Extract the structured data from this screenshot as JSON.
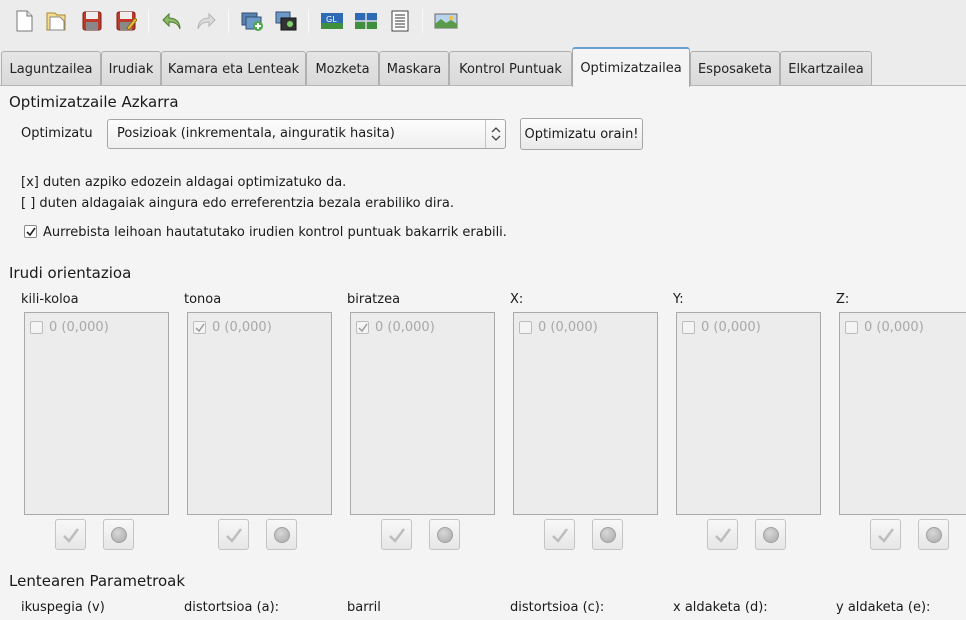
{
  "toolbar": {
    "icons": [
      "new-file-icon",
      "open-file-icon",
      "save-icon",
      "save-as-icon",
      "undo-icon",
      "redo-icon",
      "add-images-icon",
      "add-control-points-icon",
      "gl-preview-icon",
      "preview-icon",
      "list-icon",
      "panorama-icon"
    ],
    "gl_label": "GL"
  },
  "tabs": [
    "Laguntzailea",
    "Irudiak",
    "Kamara eta Lenteak",
    "Mozketa",
    "Maskara",
    "Kontrol Puntuak",
    "Optimizatzailea",
    "Esposaketa",
    "Elkartzailea"
  ],
  "active_tab": "Optimizatzailea",
  "optimizer": {
    "heading": "Optimizatzaile Azkarra",
    "optimize_label": "Optimizatu",
    "combo_value": "Posizioak (inkrementala, ainguratik hasita)",
    "optimize_now": "Optimizatu orain!",
    "info1": "[x] duten azpiko edozein aldagai optimizatuko da.",
    "info2": "[ ] duten aldagaiak aingura edo erreferentzia bezala erabiliko dira.",
    "preview_only_label": "Aurrebista leihoan hautatutako irudien kontrol puntuak bakarrik erabili.",
    "preview_only_checked": true
  },
  "orientation": {
    "heading": "Irudi orientazioa",
    "columns": [
      {
        "label": "kili-koloa",
        "item": "0 (0,000)",
        "checked": false
      },
      {
        "label": "tonoa",
        "item": "0 (0,000)",
        "checked": true
      },
      {
        "label": "biratzea",
        "item": "0 (0,000)",
        "checked": true
      },
      {
        "label": "X:",
        "item": "0 (0,000)",
        "checked": false
      },
      {
        "label": "Y:",
        "item": "0 (0,000)",
        "checked": false
      },
      {
        "label": "Z:",
        "item": "0 (0,000)",
        "checked": false
      }
    ]
  },
  "lens": {
    "heading": "Lentearen Parametroak",
    "columns": [
      "ikuspegia (v)",
      "distortsioa (a):",
      "barril",
      "distortsioa (c):",
      "x aldaketa (d):",
      "y aldaketa (e):"
    ]
  }
}
